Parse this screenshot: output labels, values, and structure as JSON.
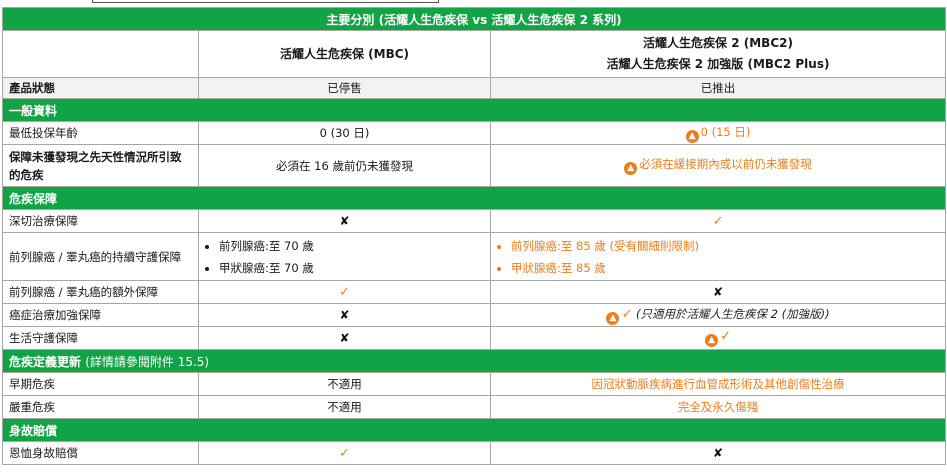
{
  "title": "主要分別 (活耀人生危疾保 vs 活耀人生危疾保 2 系列)",
  "products": {
    "col1": "活耀人生危疾保 (MBC)",
    "col2_line1": "活耀人生危疾保 2 (MBC2)",
    "col2_line2": "活耀人生危疾保 2 加強版 (MBC2 Plus)"
  },
  "status": {
    "label": "產品狀態",
    "col1": "已停售",
    "col2": "已推出"
  },
  "sections": {
    "general": "一般資料",
    "critical": "危疾保障",
    "definition": "危疾定義更新",
    "definition_note": "(詳情請參閱附件 15.5)",
    "death": "身故賠償"
  },
  "rows": {
    "min_age": {
      "label": "最低投保年齡",
      "col1": "0 (30 日)",
      "col2": "0 (15 日)"
    },
    "congenital": {
      "label": "保障未獲發現之先天性情況所引致的危疾",
      "col1": "必須在 16 歲前仍未獲發現",
      "col2": "必須在緩接期內或以前仍未獲發現"
    },
    "deep_treatment": {
      "label": "深切治療保障"
    },
    "prostate_continuous": {
      "label": "前列腺癌 / 睪丸癌的持續守護保障",
      "col1_a": "前列腺癌:至 70 歲",
      "col1_b": "甲狀腺癌:至 70 歲",
      "col2_a": "前列腺癌:至 85 歲 (受有關細則限制)",
      "col2_b": "甲狀腺癌:至 85 歲"
    },
    "prostate_extra": {
      "label": "前列腺癌 / 睪丸癌的額外保障"
    },
    "cancer_enhanced": {
      "label": "癌症治療加強保障",
      "col2_note": "(只適用於活耀人生危疾保 2 (加強版))"
    },
    "life_guard": {
      "label": "生活守護保障"
    },
    "early": {
      "label": "早期危疾",
      "col1": "不適用",
      "col2": "因冠狀動脈疾病進行血管成形術及其他創傷性治療"
    },
    "severe": {
      "label": "嚴重危疾",
      "col1": "不適用",
      "col2": "完全及永久傷殘"
    },
    "compassion": {
      "label": "恩恤身故賠償"
    }
  },
  "symbols": {
    "tick": "✓",
    "cross": "✘",
    "thumb": "👍"
  },
  "colors": {
    "header_green": "#12a347",
    "highlight_orange": "#ee7d1f",
    "status_gray": "#f2f2f2"
  }
}
